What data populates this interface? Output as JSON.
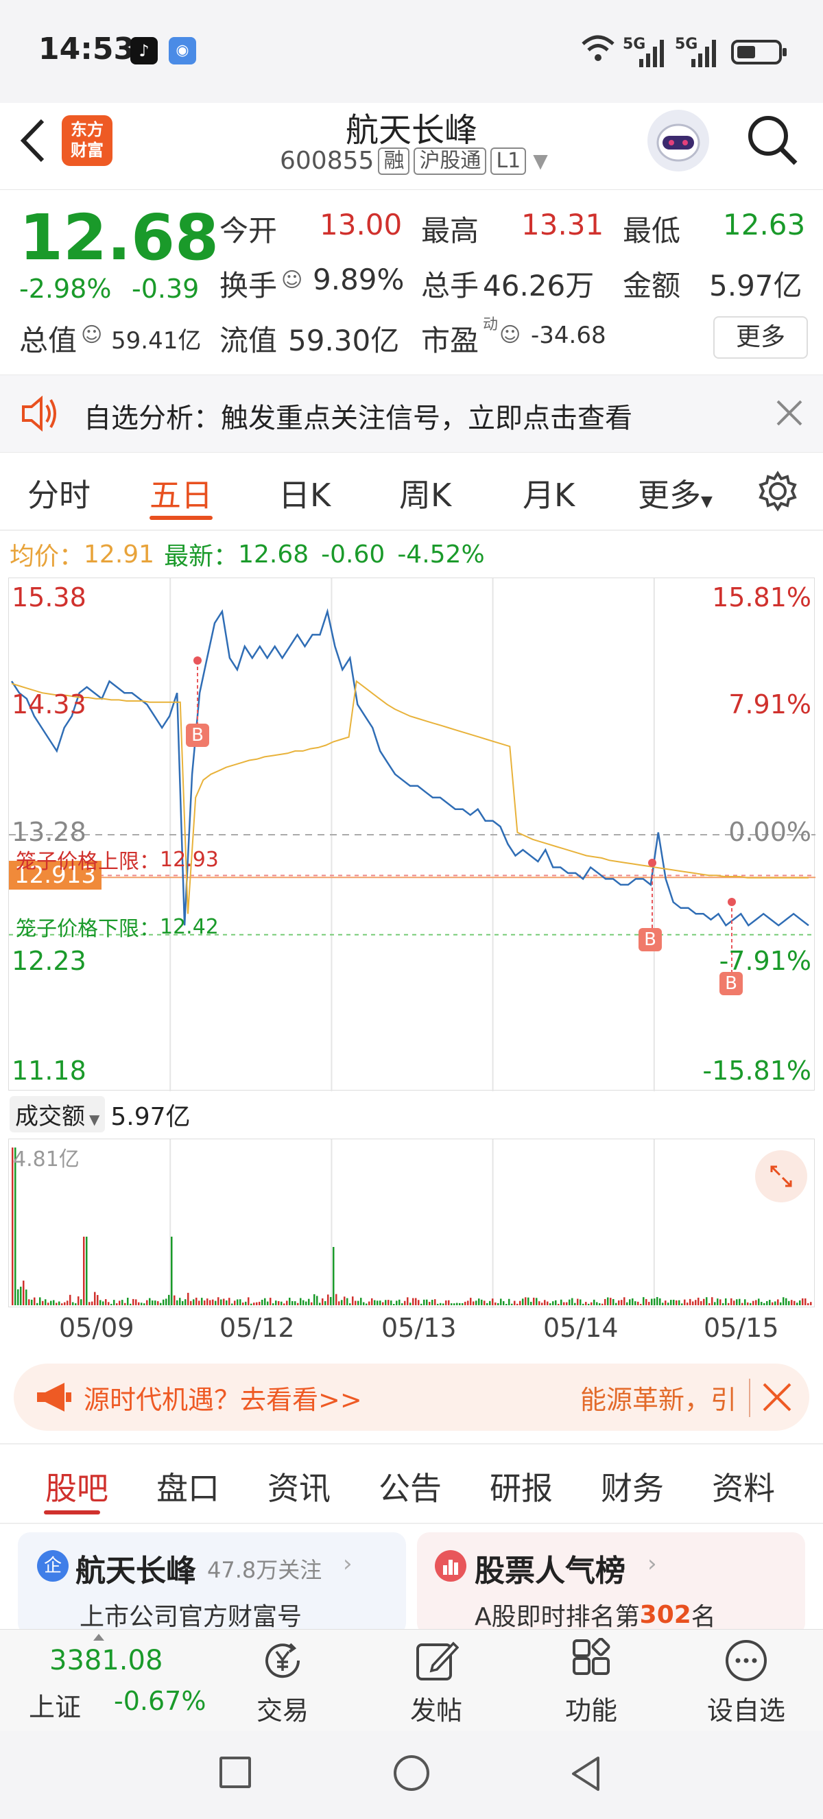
{
  "status": {
    "time": "14:53",
    "signal1": "5G",
    "signal2": "5G"
  },
  "header": {
    "back_icon": "chevron-left-icon",
    "logo_text": "东方\n财富",
    "logo_line1": "东方",
    "logo_line2": "财富",
    "title": "航天长峰",
    "code": "600855",
    "tag_margin": "融",
    "tag_connect": "沪股通",
    "tag_level": "L1"
  },
  "quote": {
    "price": "12.68",
    "change_pct": "-2.98%",
    "change": "-0.39",
    "open_label": "今开",
    "open": "13.00",
    "high_label": "最高",
    "high": "13.31",
    "low_label": "最低",
    "low": "12.63",
    "turnover_label": "换手",
    "turnover": "9.89%",
    "volume_label": "总手",
    "volume": "46.26万",
    "amount_label": "金额",
    "amount": "5.97亿",
    "mktcap_label": "总值",
    "mktcap": "59.41亿",
    "float_label": "流值",
    "float": "59.30亿",
    "pe_label": "市盈",
    "pe_sup": "动",
    "pe": "-34.68",
    "more_button": "更多"
  },
  "alert": {
    "text": "自选分析：触发重点关注信号，立即点击查看"
  },
  "chart_tabs": [
    "分时",
    "五日",
    "日K",
    "周K",
    "月K",
    "更多"
  ],
  "chart_tabs_active": 1,
  "chart_info": {
    "avg_label": "均价：",
    "avg": "12.91",
    "latest_label": "最新：",
    "latest": "12.68",
    "latest_change": "-0.60",
    "latest_pct": "-4.52%"
  },
  "chart_data": {
    "type": "line",
    "left_ticks": [
      "15.38",
      "14.33",
      "13.28",
      "12.23",
      "11.18"
    ],
    "right_ticks": [
      "15.81%",
      "7.91%",
      "0.00%",
      "-7.91%",
      "-15.81%"
    ],
    "ylim": [
      11.18,
      15.38
    ],
    "x_labels": [
      "05/09",
      "05/12",
      "05/13",
      "05/14",
      "05/15"
    ],
    "current_price_tag": "12.913",
    "upper_limit_label": "笼子价格上限：",
    "upper_limit": "12.93",
    "lower_limit_label": "笼子价格下限：",
    "lower_limit": "12.42",
    "buy_marker": "B",
    "series": [
      {
        "values": [
          14.6,
          14.5,
          14.45,
          14.3,
          14.2,
          14.1,
          14.0,
          14.2,
          14.3,
          14.5,
          14.55,
          14.5,
          14.45,
          14.6,
          14.55,
          14.5,
          14.5,
          14.45,
          14.4,
          14.3,
          14.2,
          14.3,
          14.5,
          12.5,
          13.8,
          14.5,
          14.8,
          15.1,
          15.2,
          14.8,
          14.7,
          14.9,
          14.8,
          14.9,
          14.8,
          14.9,
          14.8,
          14.9,
          15.0,
          14.9,
          15.0,
          15.0,
          15.2,
          14.9,
          14.7,
          14.8,
          14.4,
          14.3,
          14.2,
          14.0,
          13.9,
          13.8,
          13.75,
          13.7,
          13.7,
          13.65,
          13.6,
          13.6,
          13.55,
          13.5,
          13.5,
          13.45,
          13.5,
          13.4,
          13.4,
          13.35,
          13.2,
          13.1,
          13.15,
          13.1,
          13.05,
          13.15,
          13.0,
          13.0,
          12.95,
          12.95,
          12.9,
          13.0,
          12.95,
          12.9,
          12.9,
          12.85,
          12.85,
          12.9,
          12.9,
          12.85,
          13.3,
          12.9,
          12.7,
          12.65,
          12.65,
          12.6,
          12.6,
          12.55,
          12.6,
          12.5,
          12.55,
          12.6,
          12.5,
          12.55,
          12.6,
          12.55,
          12.5,
          12.55,
          12.6,
          12.55,
          12.5
        ]
      },
      {
        "values": [
          14.58,
          14.56,
          14.54,
          14.52,
          14.5,
          14.49,
          14.48,
          14.48,
          14.47,
          14.46,
          14.46,
          14.45,
          14.45,
          14.44,
          14.44,
          14.43,
          14.43,
          14.43,
          14.42,
          14.42,
          14.42,
          14.42,
          14.42,
          12.6,
          13.6,
          13.75,
          13.8,
          13.83,
          13.86,
          13.88,
          13.9,
          13.92,
          13.93,
          13.95,
          13.96,
          13.97,
          13.98,
          14.0,
          14.0,
          14.02,
          14.03,
          14.05,
          14.08,
          14.1,
          14.12,
          14.6,
          14.55,
          14.5,
          14.45,
          14.4,
          14.36,
          14.33,
          14.3,
          14.28,
          14.26,
          14.24,
          14.22,
          14.2,
          14.18,
          14.16,
          14.14,
          14.12,
          14.1,
          14.08,
          14.06,
          14.04,
          13.3,
          13.27,
          13.24,
          13.22,
          13.2,
          13.18,
          13.16,
          13.14,
          13.12,
          13.1,
          13.09,
          13.08,
          13.06,
          13.05,
          13.04,
          13.03,
          13.02,
          13.01,
          13.0,
          12.99,
          12.98,
          12.97,
          12.96,
          12.95,
          12.94,
          12.93,
          12.93,
          12.92,
          12.92,
          12.92,
          12.91,
          12.91,
          12.91,
          12.91,
          12.91,
          12.91,
          12.91,
          12.91,
          12.91
        ]
      }
    ]
  },
  "volume": {
    "selector": "成交额",
    "total": "5.97亿",
    "max_label": "4.81亿"
  },
  "ad_banner": {
    "left": "源时代机遇？去看看>>",
    "right": "能源革新，引"
  },
  "sub_tabs": [
    "股吧",
    "盘口",
    "资讯",
    "公告",
    "研报",
    "财务",
    "资料"
  ],
  "sub_tabs_active": 0,
  "cards": [
    {
      "title": "航天长峰",
      "extra": "47.8万关注",
      "subtitle": "上市公司官方财富号",
      "badge": "企"
    },
    {
      "title": "股票人气榜",
      "sub_prefix": "A股即时排名第",
      "rank": "302",
      "sub_suffix": "名"
    }
  ],
  "index": {
    "value": "3381.08",
    "name": "上证",
    "change": "-0.67%"
  },
  "nav": [
    "交易",
    "发帖",
    "功能",
    "设自选"
  ],
  "colors": {
    "accent": "#e8501f",
    "up": "#d0312d",
    "down": "#1a9a2a",
    "line": "#2f6db5",
    "avg": "#e8b23a"
  }
}
